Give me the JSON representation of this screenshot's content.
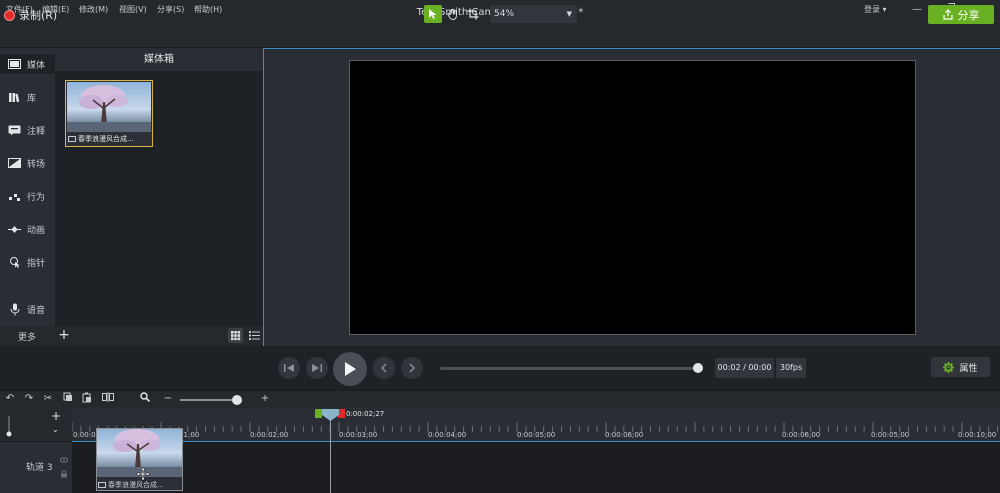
{
  "window": {
    "title": "TechSmith Camtasia - 未命名项目*",
    "menu": [
      "文件(F)",
      "编辑(E)",
      "修改(M)",
      "视图(V)",
      "分享(S)",
      "帮助(H)"
    ],
    "login_label": "登录 ▾"
  },
  "toolbar": {
    "record_label": "录制(R)",
    "zoom_value": "54%",
    "share_label": "分享"
  },
  "nav": {
    "items": [
      {
        "label": "媒体",
        "icon": "film-icon"
      },
      {
        "label": "库",
        "icon": "library-icon"
      },
      {
        "label": "注释",
        "icon": "annotation-icon"
      },
      {
        "label": "转场",
        "icon": "transition-icon"
      },
      {
        "label": "行为",
        "icon": "behavior-icon"
      },
      {
        "label": "动画",
        "icon": "animation-icon"
      },
      {
        "label": "指针",
        "icon": "cursor-icon"
      },
      {
        "label": "语音",
        "icon": "microphone-icon"
      }
    ],
    "more_label": "更多"
  },
  "bin": {
    "title": "媒体箱",
    "media": [
      {
        "caption": "春季浪漫风合成..."
      }
    ]
  },
  "playback": {
    "time": "00:02 / 00:00",
    "fps": "30fps",
    "properties_label": "属性",
    "scrub_position": 1.0
  },
  "timeline": {
    "playhead_time": "0:00:02;27",
    "ticks": [
      "0:00:00;00",
      "0:00:01;00",
      "0:00:02;00",
      "0:00:03;00",
      "0:00:04;00",
      "0:00:05;00",
      "0:00:06;00",
      "0:00:06;00",
      "0:00:05;00",
      "0:00:10;00"
    ],
    "track_label": "轨道 3",
    "clip_caption": "春季浪漫风合成..."
  },
  "colors": {
    "accent_green": "#6ab023",
    "record_red": "#e02c2c",
    "selection_blue": "#3c8fc6"
  }
}
